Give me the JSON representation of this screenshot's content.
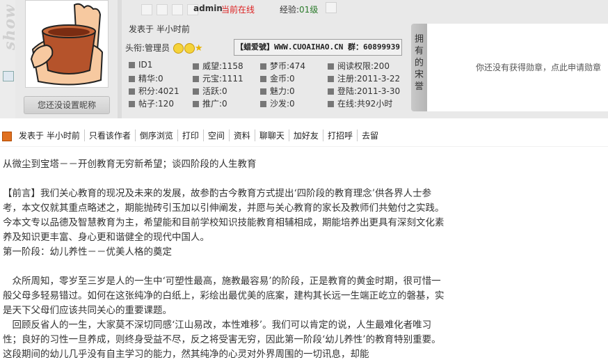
{
  "sidebar": {
    "watermark": "show"
  },
  "user": {
    "name": "admin",
    "online_status": "当前在线",
    "exp_label": "经验:",
    "exp_value": "01级",
    "posted": "发表于 半小时前",
    "title_label": "头衔:管理员",
    "nickname_button": "您还没设置昵称",
    "banner": "【蜡爱號】WWW.CUOAIHAO.CN  群：60899939"
  },
  "stats": [
    "ID1",
    "威望:1158",
    "梦币:474",
    "阅读权限:200",
    "精华:0",
    "元宝:1111",
    "金币:0",
    "注册:2011-3-22",
    "积分:4021",
    "活跃:0",
    "魅力:0",
    "登陆:2011-3-30",
    "帖子:120",
    "推广:0",
    "沙发:0",
    "在线:共92小时"
  ],
  "medals": {
    "tab_label": "拥有的宋誉",
    "empty_text": "你还没有获得勋章，点此申请勋章"
  },
  "actions": {
    "posted": "发表于 半小时前",
    "only_author": "只看该作者",
    "reverse": "倒序浏览",
    "print": "打印",
    "space": "空间",
    "profile": "资料",
    "chat": "聊聊天",
    "add_friend": "加好友",
    "greet": "打招呼",
    "leave": "去留"
  },
  "article": {
    "title": "从微尘到宝塔－－开创教育无穷新希望；谈四阶段的人生教育",
    "para1": "【前言】我们关心教育的现况及未来的发展，故参酌古今教育方式提出‘四阶段的教育理念’供各界人士参考，本文仅就其重点略述之，期能抛砖引玉加以引伸阐发，并愿与关心教育的家长及教师们共勉付之实践。今本文专以品德及智慧教育为主，希望能和目前学校知识技能教育相辅相成，期能培养出更具有深刻文化素养及知识更丰富、身心更和谐健全的现代中国人。",
    "stage1": "第一阶段：幼儿养性－－优美人格的奠定",
    "para2": "　众所周知，零岁至三岁是人的一生中‘可塑性最高，施教最容易’的阶段，正是教育的黄金时期，很可惜一般父母多轻易错过。如何在这张纯净的白纸上，彩绘出最优美的底案，建构其长远一生端正屹立的磐基，实是天下父母们应该共同关心的重要课题。",
    "para3": "　回顾反省人的一生，大家莫不深切同感‘江山易改，本性难移’。我们可以肯定的说，人生最难化者唯习性；良好的习性一旦养成，则终身受益不尽，反之将受害无穷，因此第一阶段‘幼儿养性’的教育特别重要。这段期间的幼儿几乎没有自主学习的能力，然其纯净的心灵对外界周围的一切讯息，却能"
  },
  "colors": {
    "online": "#dd2222",
    "exp": "#2a7a2a",
    "header_bg": "#e9e9e9"
  }
}
